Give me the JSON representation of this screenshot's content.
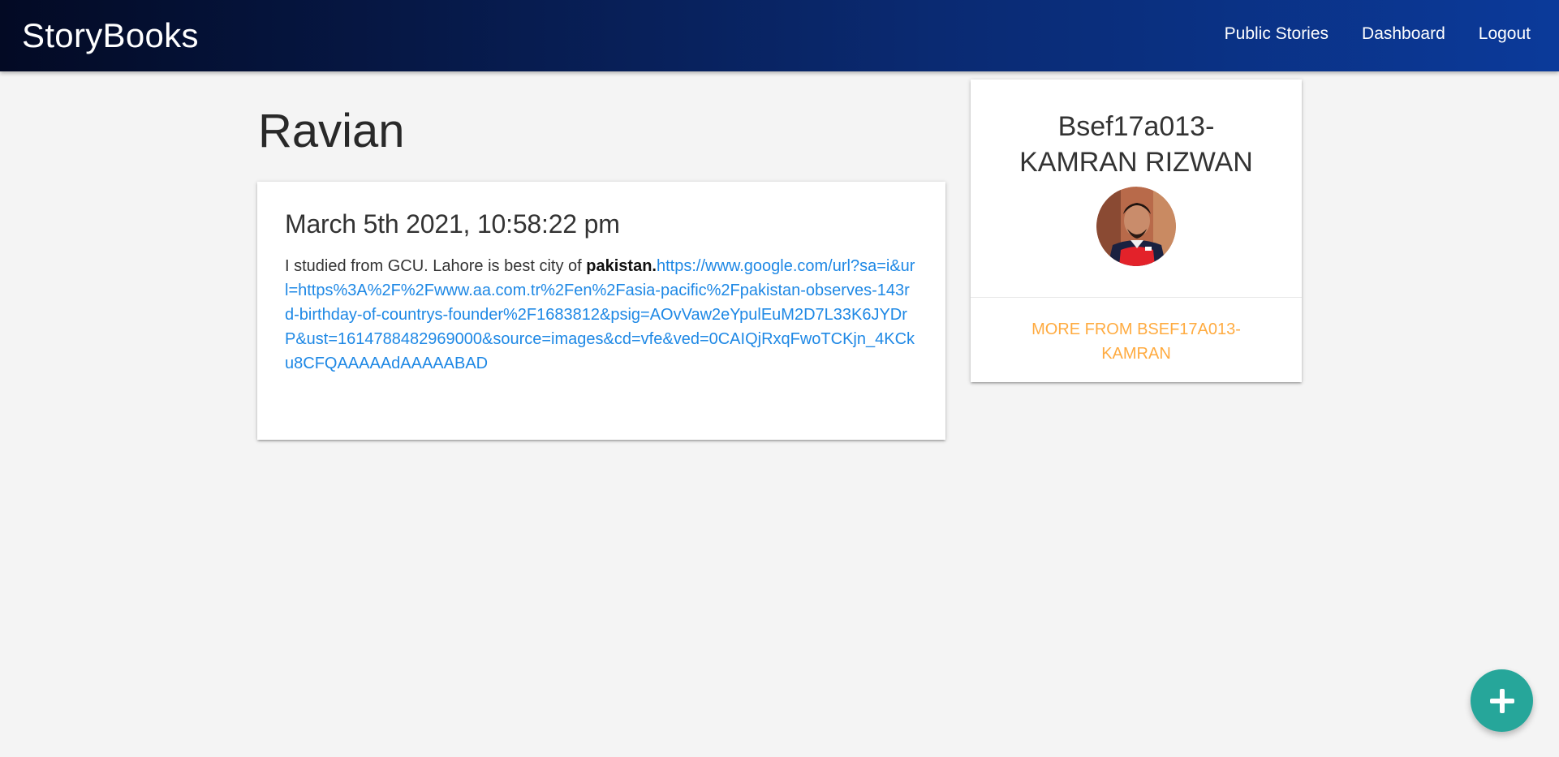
{
  "nav": {
    "brand": "StoryBooks",
    "links": [
      "Public Stories",
      "Dashboard",
      "Logout"
    ]
  },
  "story": {
    "title": "Ravian",
    "date": "March 5th 2021, 10:58:22 pm",
    "body_text": "I studied from GCU. Lahore is best city of ",
    "body_bold": "pakistan.",
    "body_link": "https://www.google.com/url?sa=i&url=https%3A%2F%2Fwww.aa.com.tr%2Fen%2Fasia-pacific%2Fpakistan-observes-143rd-birthday-of-countrys-founder%2F1683812&psig=AOvVaw2eYpulEuM2D7L33K6JYDrP&ust=1614788482969000&source=images&cd=vfe&ved=0CAIQjRxqFwoTCKjn_4KCku8CFQAAAAAdAAAAABAD"
  },
  "author": {
    "name": "Bsef17a013-KAMRAN RIZWAN",
    "more_link": "More From Bsef17a013-KAMRAN"
  },
  "fab": {
    "icon": "add-icon",
    "color": "#26a69a"
  },
  "colors": {
    "link": "#1e88e5",
    "accent": "#ffab40"
  }
}
